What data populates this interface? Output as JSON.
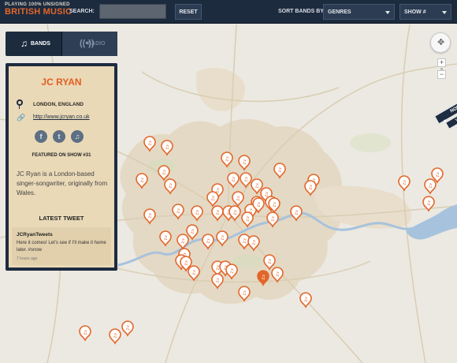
{
  "header": {
    "logo_line1": "PLAYING 100% UNSIGNED",
    "logo_line2": "BRITISH MUSIC",
    "search_label": "SEARCH:",
    "search_value": "",
    "reset_label": "RESET",
    "sort_label": "SORT BANDS BY:",
    "sort_selected": "GENRES",
    "show_selected": "SHOW #"
  },
  "tabs": {
    "bands_label": "BANDS",
    "radio_label": "RADIO",
    "bands_icon": "music-note-icon",
    "radio_icon": "broadcast-icon"
  },
  "band": {
    "name": "JC RYAN",
    "location": "LONDON, ENGLAND",
    "website": "http://www.jcryan.co.uk",
    "social_icons": [
      "facebook-icon",
      "twitter-icon",
      "music-icon"
    ],
    "featured": "FEATURED ON SHOW #31",
    "bio": "JC Ryan is a London-based singer-songwriter, originally from Wales.",
    "latest_tweet_heading": "LATEST TWEET",
    "tweet_user": "JCRyanTweets",
    "tweet_text": "Here it comes! Let's see if I'll make it home later. #snow",
    "tweet_time": "7 hours ago"
  },
  "map": {
    "controls": [
      "pan-control",
      "zoom-in",
      "zoom-out"
    ],
    "ribbon_line1": "NOMINEE",
    "ribbon_line2": "VOTE for us",
    "colors": {
      "marker": "#e2662a",
      "marker_selected": "#e2662a",
      "land": "#ece9e2",
      "urban": "#e4d9c4",
      "water": "#a7c2dc",
      "header_bg": "#1d2b3f",
      "accent": "#e25d20"
    },
    "marker_count": 58,
    "selected_marker_count": 1
  }
}
